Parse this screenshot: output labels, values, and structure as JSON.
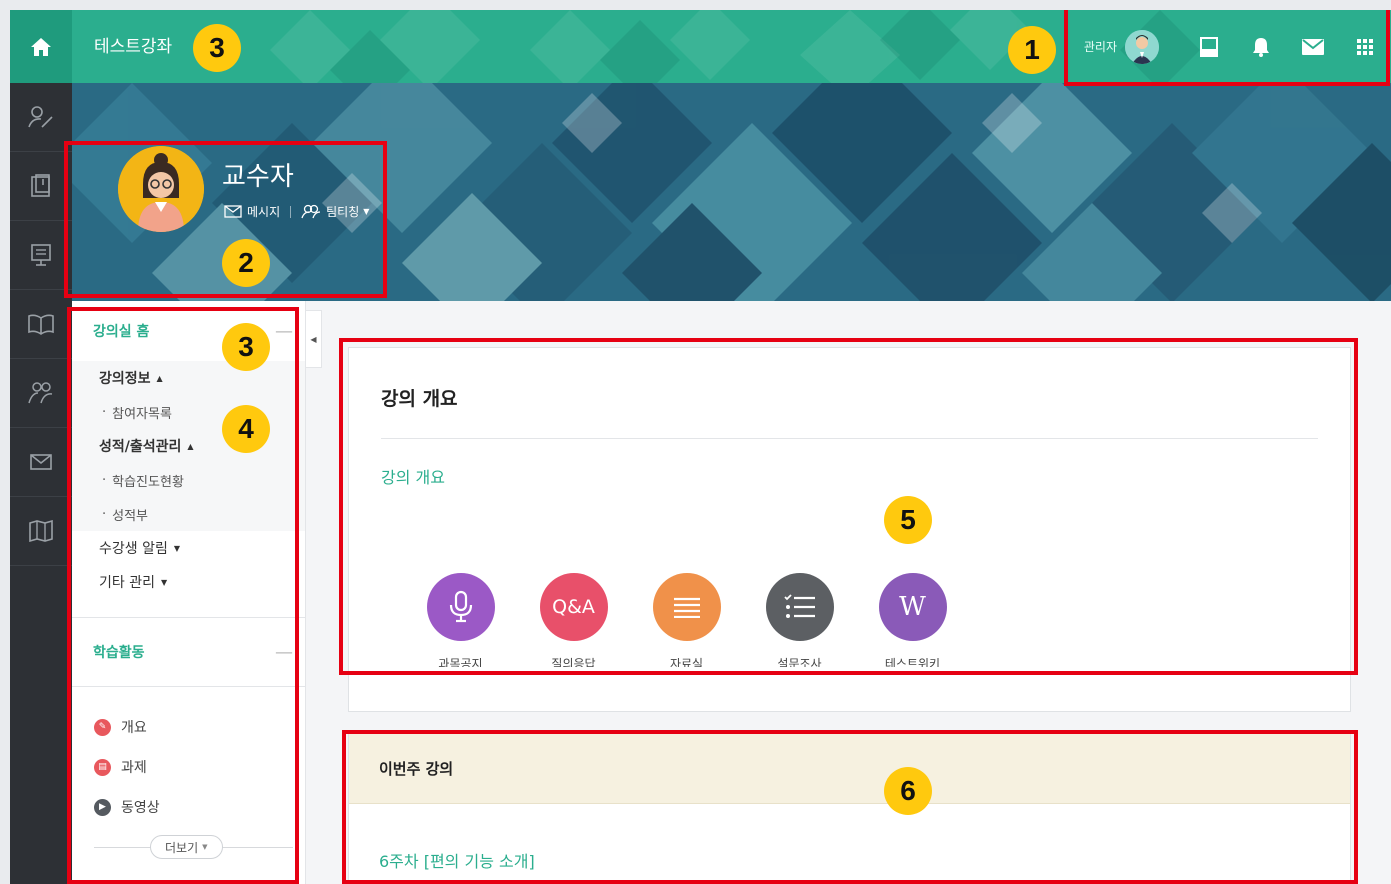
{
  "topbar": {
    "course_title": "테스트강좌",
    "user_label": "관리자",
    "icons": [
      "home-icon",
      "layout-icon",
      "bell-icon",
      "mail-icon",
      "apps-grid-icon"
    ]
  },
  "leftnav": {
    "icons": [
      "pen-person-icon",
      "book-icon",
      "board-icon",
      "open-book-icon",
      "people-icon",
      "envelope-icon",
      "map-icon"
    ]
  },
  "profile": {
    "name": "교수자",
    "message_label": "메시지",
    "teamteaching_label": "팀티칭"
  },
  "course_menu": {
    "home_label": "강의실 홈",
    "groups": [
      {
        "label": "강의정보",
        "children": [
          "참여자목록"
        ]
      },
      {
        "label": "성적/출석관리",
        "children": [
          "학습진도현황",
          "성적부"
        ]
      }
    ],
    "notify_label": "수강생 알림",
    "etc_label": "기타 관리",
    "activities_title": "학습활동",
    "activities": [
      {
        "label": "개요",
        "color": "#e8585d"
      },
      {
        "label": "과제",
        "color": "#e8585d"
      },
      {
        "label": "동영상",
        "color": "#555a60"
      }
    ],
    "more_label": "더보기"
  },
  "overview": {
    "heading": "강의 개요",
    "link": "강의 개요",
    "modules": [
      {
        "label": "과목공지",
        "color": "#9b59c6",
        "icon": "microphone-icon"
      },
      {
        "label": "질의응답",
        "color": "#e8506a",
        "icon": "qa-icon",
        "text": "Q&A"
      },
      {
        "label": "자료실",
        "color": "#f0914a",
        "icon": "list-lines-icon"
      },
      {
        "label": "설문조사",
        "color": "#5c5f63",
        "icon": "checklist-icon"
      },
      {
        "label": "테스트위키",
        "color": "#8a5ab8",
        "icon": "wiki-icon",
        "text": "W"
      }
    ]
  },
  "this_week": {
    "heading": "이번주 강의",
    "link": "6주차 [편의 기능 소개]"
  },
  "annotations": [
    "1",
    "2",
    "3",
    "3",
    "4",
    "5",
    "6"
  ],
  "colors": {
    "brand_green": "#2bae8e",
    "banner_blue": "#25617b",
    "annotation_red": "#e60012",
    "badge_yellow": "#ffc90e"
  }
}
